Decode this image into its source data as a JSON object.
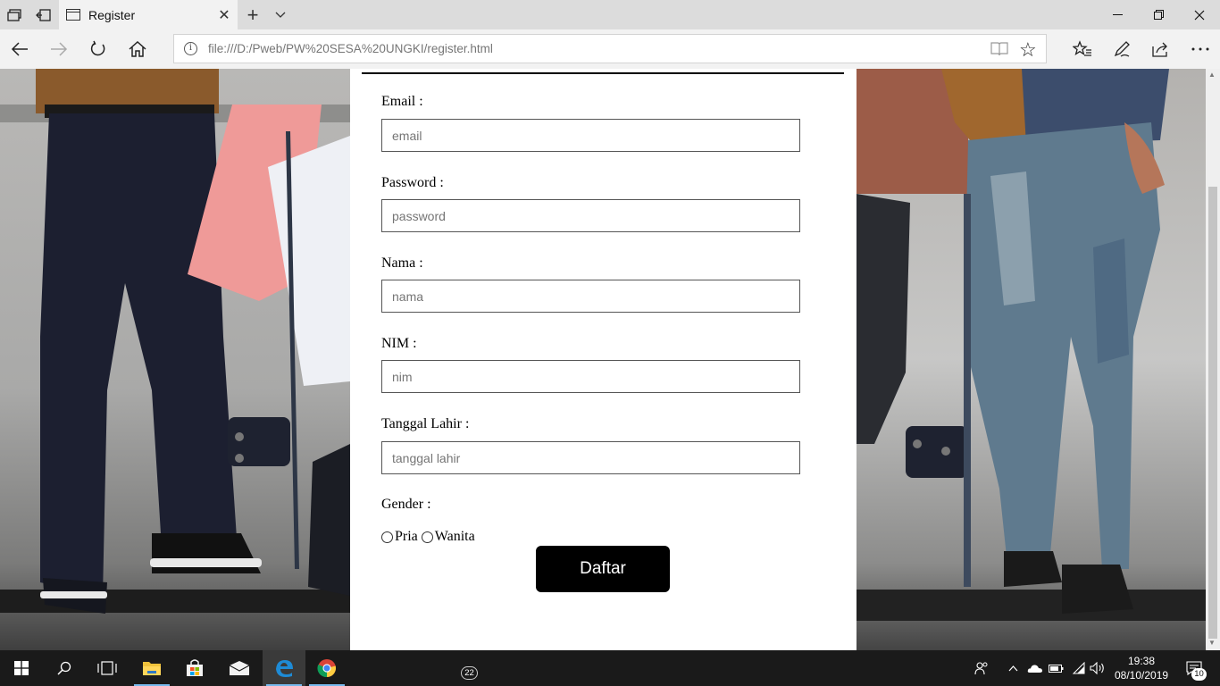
{
  "browser": {
    "tab_title": "Register",
    "url": "file:///D:/Pweb/PW%20SESA%20UNGKI/register.html",
    "icons": {
      "set_aside": "tabs-aside-icon",
      "show_aside": "tabs-restore-icon",
      "page": "page-icon",
      "close_tab": "close-icon",
      "new_tab": "plus-icon",
      "tab_preview": "chevron-down-icon",
      "minimize": "minimize-icon",
      "restore": "restore-icon",
      "close_window": "close-icon",
      "back": "back-arrow-icon",
      "forward": "forward-arrow-icon",
      "refresh": "refresh-icon",
      "home": "home-icon",
      "info": "info-icon",
      "reading_view": "book-icon",
      "favorite": "star-icon",
      "favorites_hub": "favorites-list-icon",
      "notes": "pen-icon",
      "share": "share-icon",
      "more": "more-icon"
    }
  },
  "form": {
    "fields": [
      {
        "label": "Email :",
        "placeholder": "email"
      },
      {
        "label": "Password :",
        "placeholder": "password"
      },
      {
        "label": "Nama :",
        "placeholder": "nama"
      },
      {
        "label": "NIM :",
        "placeholder": "nim"
      },
      {
        "label": "Tanggal Lahir :",
        "placeholder": "tanggal lahir"
      }
    ],
    "gender_label": "Gender :",
    "gender_options": [
      "Pria",
      "Wanita"
    ],
    "submit_label": "Daftar"
  },
  "taskbar": {
    "mail_badge": "22",
    "time": "19:38",
    "date": "08/10/2019",
    "notifications": "10",
    "colors": {
      "accent": "#76b9ed",
      "edge": "#1e8bd6"
    }
  }
}
